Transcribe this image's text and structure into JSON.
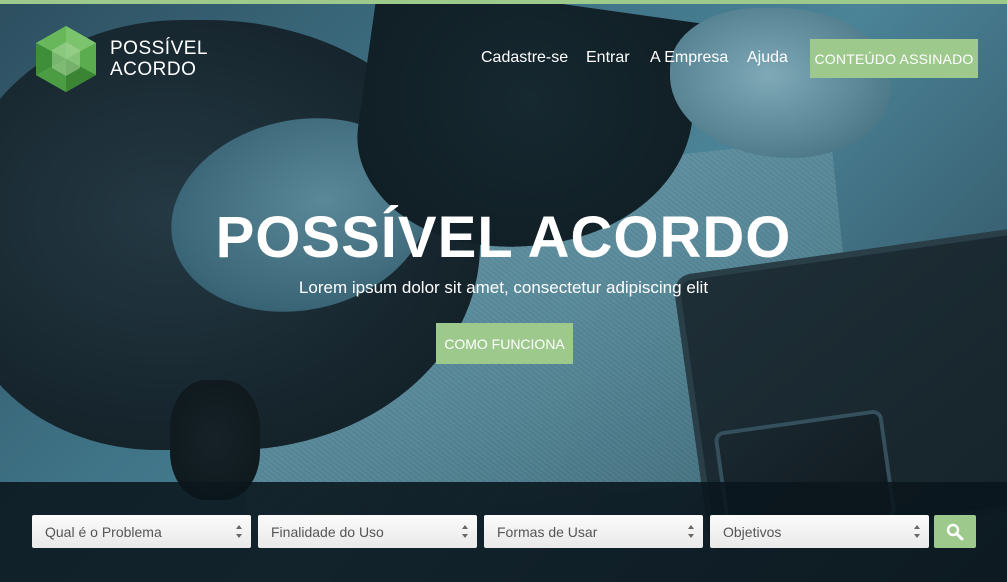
{
  "brand": {
    "logo_line1": "POSSÍVEL",
    "logo_line2": "ACORDO",
    "accent_color": "#9dc98c"
  },
  "nav": {
    "items": [
      "Cadastre-se",
      "Entrar",
      "A Empresa",
      "Ajuda"
    ],
    "cta": "CONTEÚDO ASSINADO"
  },
  "hero": {
    "title": "POSSÍVEL ACORDO",
    "subtitle": "Lorem ipsum dolor sit amet, consectetur adipiscing elit",
    "button": "COMO FUNCIONA"
  },
  "filters": {
    "selects": [
      "Qual é o Problema",
      "Finalidade do Uso",
      "Formas de Usar",
      "Objetivos"
    ],
    "search_icon": "search-icon"
  }
}
